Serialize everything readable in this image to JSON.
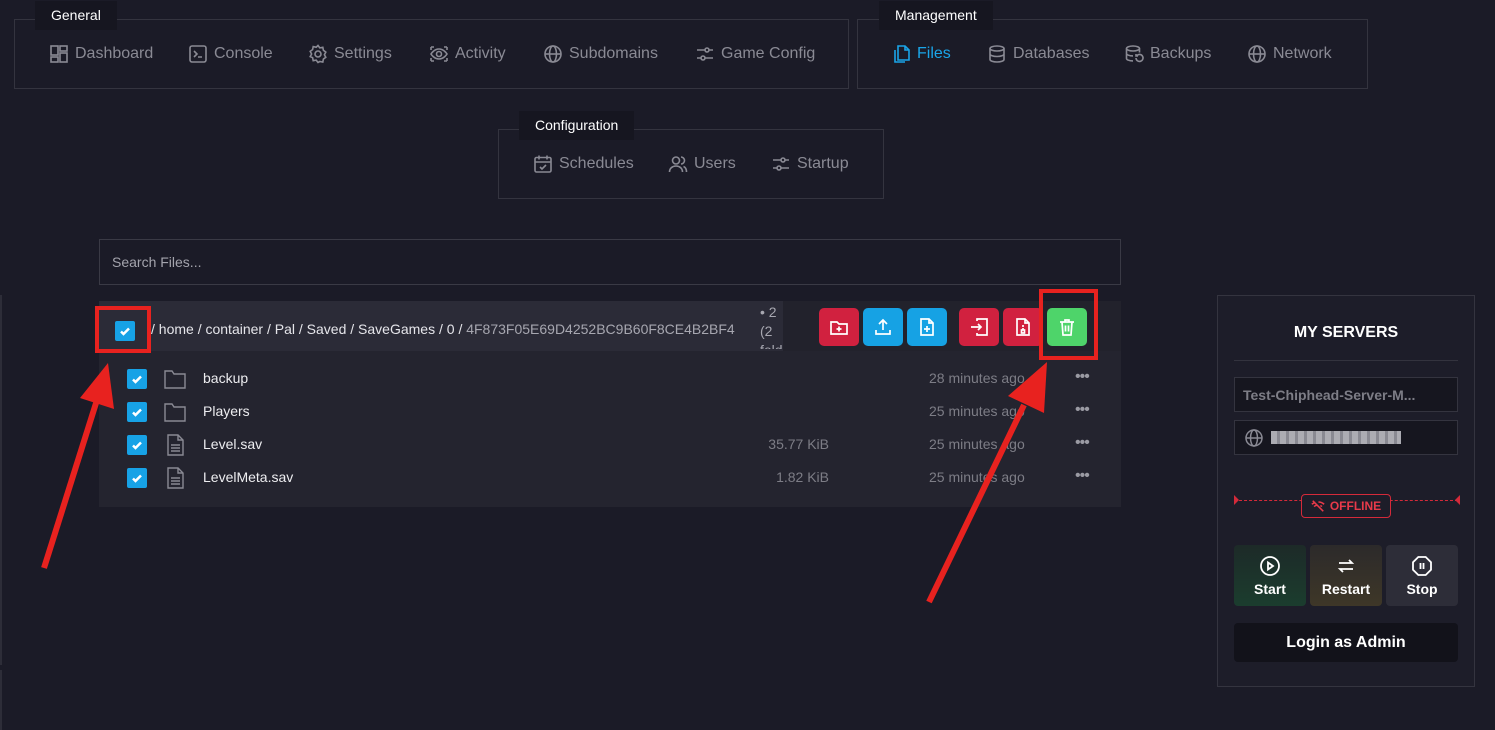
{
  "nav": {
    "general": {
      "label": "General",
      "items": [
        {
          "label": "Dashboard",
          "icon": "dashboard-icon"
        },
        {
          "label": "Console",
          "icon": "console-icon"
        },
        {
          "label": "Settings",
          "icon": "gear-icon"
        },
        {
          "label": "Activity",
          "icon": "eye-icon"
        },
        {
          "label": "Subdomains",
          "icon": "globe-icon"
        },
        {
          "label": "Game Config",
          "icon": "sliders-icon"
        }
      ]
    },
    "management": {
      "label": "Management",
      "items": [
        {
          "label": "Files",
          "icon": "files-icon",
          "active": true
        },
        {
          "label": "Databases",
          "icon": "database-icon"
        },
        {
          "label": "Backups",
          "icon": "backup-icon"
        },
        {
          "label": "Network",
          "icon": "globe-icon"
        }
      ]
    },
    "configuration": {
      "label": "Configuration",
      "items": [
        {
          "label": "Schedules",
          "icon": "calendar-icon"
        },
        {
          "label": "Users",
          "icon": "users-icon"
        },
        {
          "label": "Startup",
          "icon": "sliders-icon"
        }
      ]
    }
  },
  "search": {
    "placeholder": "Search Files..."
  },
  "breadcrumb": {
    "sep": "/",
    "parts": [
      "home",
      "container",
      "Pal",
      "Saved",
      "SaveGames",
      "0"
    ],
    "current": "4F873F05E69D4252BC9B60F8CE4B2BF4",
    "count_lines": [
      "• 2",
      "(2",
      "fold"
    ]
  },
  "files": [
    {
      "name": "backup",
      "type": "folder",
      "size": "",
      "modified": "28 minutes ago",
      "checked": true
    },
    {
      "name": "Players",
      "type": "folder",
      "size": "",
      "modified": "25 minutes ago",
      "checked": true
    },
    {
      "name": "Level.sav",
      "type": "file",
      "size": "35.77 KiB",
      "modified": "25 minutes ago",
      "checked": true
    },
    {
      "name": "LevelMeta.sav",
      "type": "file",
      "size": "1.82 KiB",
      "modified": "25 minutes ago",
      "checked": true
    }
  ],
  "toolbar": {
    "buttons": [
      "new-folder-icon",
      "upload-icon",
      "new-file-icon",
      "move-icon",
      "archive-icon",
      "trash-icon"
    ]
  },
  "servers": {
    "title": "MY SERVERS",
    "server_name": "Test-Chiphead-Server-M...",
    "status": "OFFLINE",
    "start_label": "Start",
    "restart_label": "Restart",
    "stop_label": "Stop",
    "admin_label": "Login as Admin"
  },
  "colors": {
    "background": "#1b1b27",
    "accent": "#1aa5e8",
    "danger": "#d1213f",
    "success": "#4ed46a",
    "annotation": "#e8221f"
  }
}
